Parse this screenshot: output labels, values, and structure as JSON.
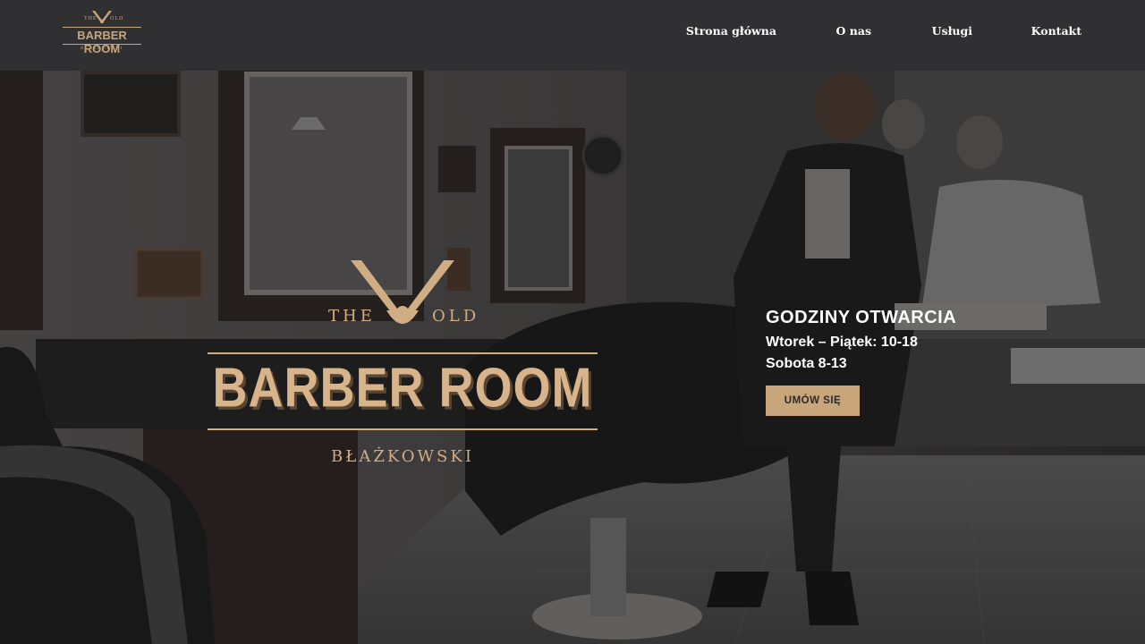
{
  "header": {
    "logo": {
      "top_left": "THE",
      "top_right": "OLD",
      "name": "BARBER ROOM",
      "sub": "BŁAŻKOWSKI"
    },
    "nav": [
      {
        "label": "Strona główna"
      },
      {
        "label": "O nas"
      },
      {
        "label": "Usługi"
      },
      {
        "label": "Kontakt"
      }
    ]
  },
  "hero": {
    "logo": {
      "top_left": "THE",
      "top_right": "OLD",
      "name": "BARBER ROOM",
      "sub": "BŁAŻKOWSKI"
    },
    "hours": {
      "title": "GODZINY OTWARCIA",
      "weekdays": "Wtorek – Piątek: 10-18",
      "saturday": "Sobota 8-13"
    },
    "cta_label": "UMÓW SIĘ"
  },
  "colors": {
    "header_bg": "#303032",
    "gold": "#c8a57a",
    "text_white": "#ffffff"
  }
}
